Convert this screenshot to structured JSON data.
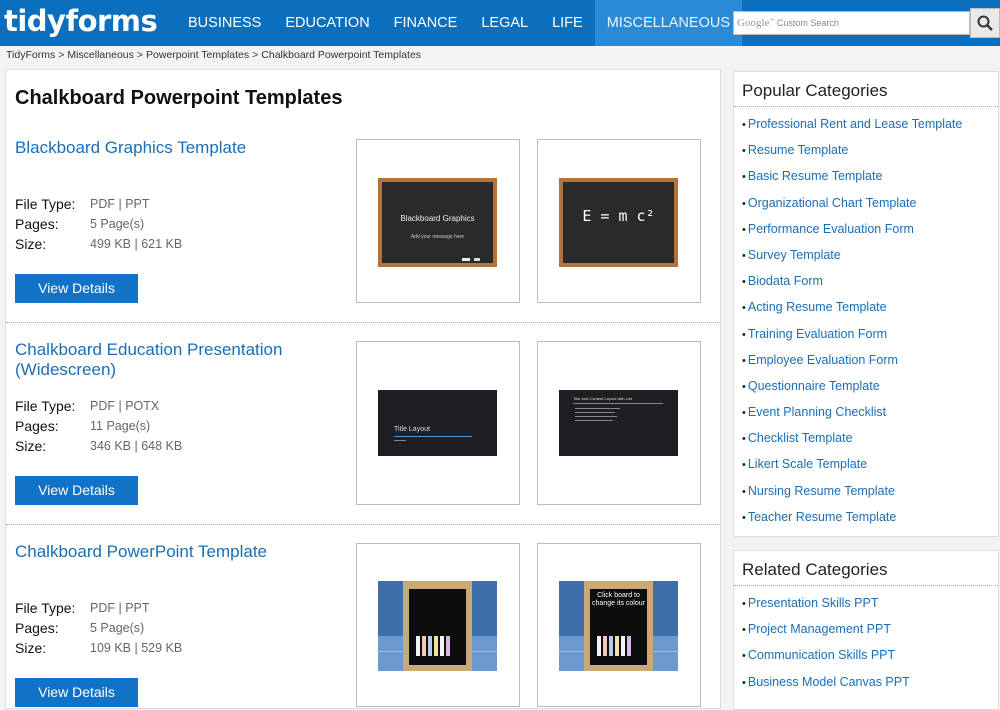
{
  "header": {
    "logo": "tidyforms",
    "nav": [
      "BUSINESS",
      "EDUCATION",
      "FINANCE",
      "LEGAL",
      "LIFE",
      "MISCELLANEOUS"
    ],
    "search_brand": "Google",
    "search_placeholder": "Custom Search"
  },
  "breadcrumb": [
    "TidyForms",
    "Miscellaneous",
    "Powerpoint Templates",
    "Chalkboard Powerpoint Templates"
  ],
  "page_title": "Chalkboard Powerpoint Templates",
  "labels": {
    "file_type": "File Type:",
    "pages": "Pages:",
    "size": "Size:",
    "view_details": "View Details"
  },
  "items": [
    {
      "title": "Blackboard Graphics Template",
      "file_type": "PDF | PPT",
      "pages": "5 Page(s)",
      "size": "499 KB | 621 KB",
      "thumb1_title": "Blackboard Graphics",
      "thumb1_sub": "Add your message here",
      "thumb2_text": "E = m c²"
    },
    {
      "title": "Chalkboard Education Presentation (Widescreen)",
      "file_type": "PDF | POTX",
      "pages": "11 Page(s)",
      "size": "346 KB | 648 KB",
      "thumb1_title": "Title Layout",
      "thumb2_title": "Title and Content Layout with List"
    },
    {
      "title": "Chalkboard PowerPoint Template",
      "file_type": "PDF | PPT",
      "pages": "5 Page(s)",
      "size": "109 KB | 529 KB",
      "thumb2_text": "Click board to change its colour"
    }
  ],
  "sidebar": {
    "popular_title": "Popular Categories",
    "popular": [
      "Professional Rent and Lease Template",
      "Resume Template",
      "Basic Resume Template",
      "Organizational Chart Template",
      "Performance Evaluation Form",
      "Survey Template",
      "Biodata Form",
      "Acting Resume Template",
      "Training Evaluation Form",
      "Employee Evaluation Form",
      "Questionnaire Template",
      "Event Planning Checklist",
      "Checklist Template",
      "Likert Scale Template",
      "Nursing Resume Template",
      "Teacher Resume Template"
    ],
    "related_title": "Related Categories",
    "related": [
      "Presentation Skills PPT",
      "Project Management PPT",
      "Communication Skills PPT",
      "Business Model Canvas PPT"
    ]
  },
  "colors": {
    "nav_bg": "#0b6fbe",
    "link": "#1a6eb8",
    "button": "#1173c7"
  }
}
